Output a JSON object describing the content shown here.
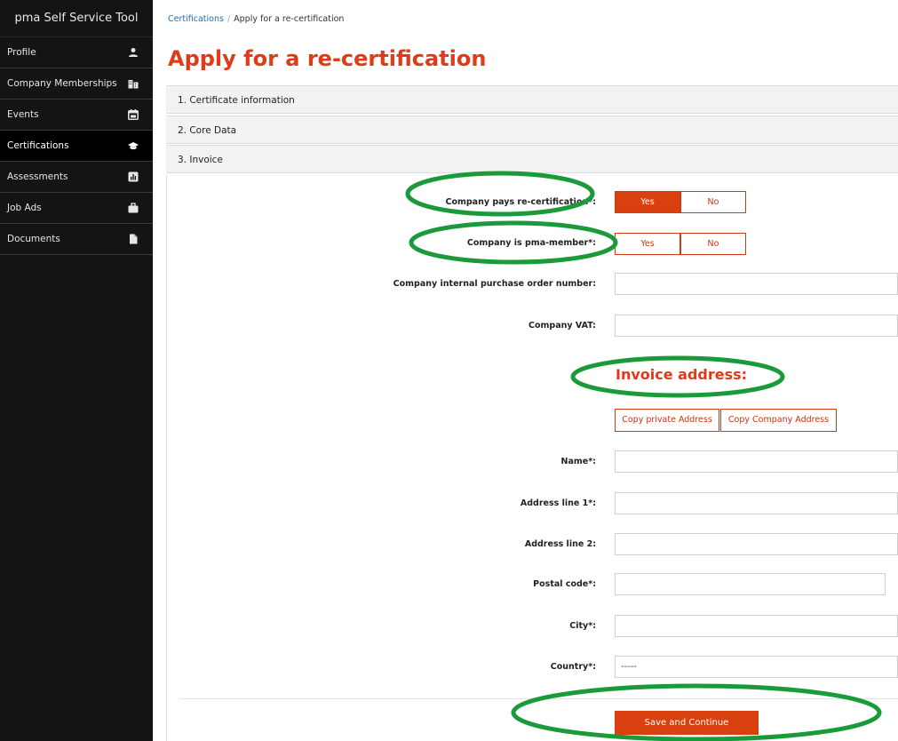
{
  "app": {
    "title": "pma Self Service Tool"
  },
  "sidebar": {
    "items": [
      {
        "label": "Profile",
        "icon": "user-icon"
      },
      {
        "label": "Company Memberships",
        "icon": "building-icon"
      },
      {
        "label": "Events",
        "icon": "calendar-icon"
      },
      {
        "label": "Certifications",
        "icon": "graduation-cap-icon",
        "active": true
      },
      {
        "label": "Assessments",
        "icon": "bar-chart-icon"
      },
      {
        "label": "Job Ads",
        "icon": "briefcase-icon"
      },
      {
        "label": "Documents",
        "icon": "file-icon"
      }
    ]
  },
  "breadcrumb": {
    "link": "Certifications",
    "separator": "/",
    "current": "Apply for a re-certification"
  },
  "page": {
    "title": "Apply for a re-certification"
  },
  "sections": [
    {
      "label": "1. Certificate information"
    },
    {
      "label": "2. Core Data"
    },
    {
      "label": "3. Invoice",
      "expanded": true
    }
  ],
  "form": {
    "company_pays": {
      "label": "Company pays re-certification*:",
      "yes": "Yes",
      "no": "No",
      "selected": "Yes"
    },
    "company_member": {
      "label": "Company is pma-member*:",
      "yes": "Yes",
      "no": "No",
      "selected": "none"
    },
    "po_number": {
      "label": "Company internal purchase order number:",
      "value": ""
    },
    "vat": {
      "label": "Company VAT:",
      "value": ""
    },
    "invoice_address": {
      "heading": "Invoice address:",
      "copy_private": "Copy private Address",
      "copy_company": "Copy Company Address"
    },
    "name": {
      "label": "Name*:",
      "value": ""
    },
    "address1": {
      "label": "Address line 1*:",
      "value": ""
    },
    "address2": {
      "label": "Address line 2:",
      "value": ""
    },
    "postal": {
      "label": "Postal code*:",
      "value": ""
    },
    "city": {
      "label": "City*:",
      "value": ""
    },
    "country": {
      "label": "Country*:",
      "value": "-----"
    },
    "submit": "Save and Continue"
  },
  "colors": {
    "accent": "#d8410f",
    "title": "#e03a1a",
    "sidebar": "#141414",
    "annotation": "#1a9a3a"
  }
}
